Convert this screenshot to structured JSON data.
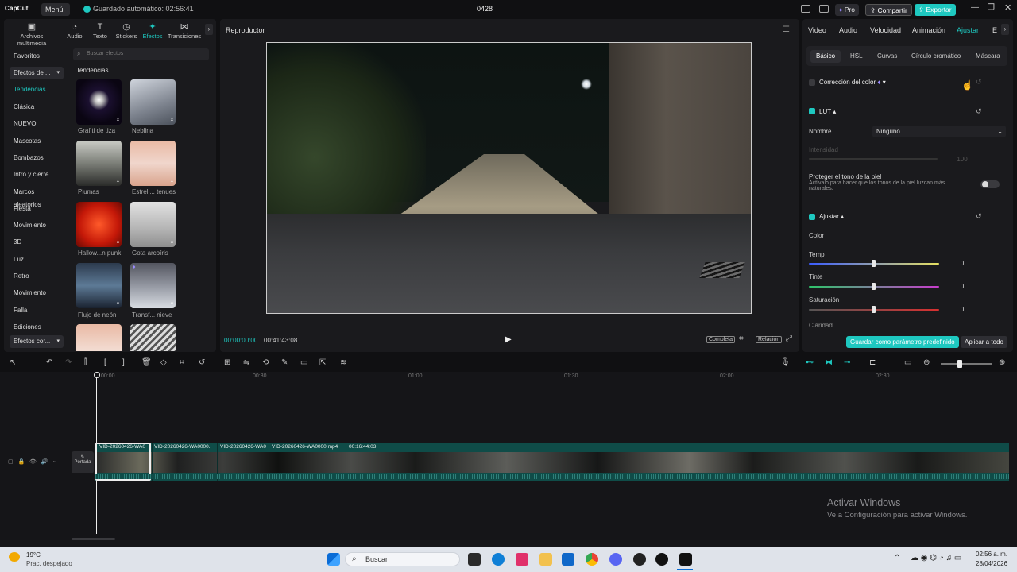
{
  "titlebar": {
    "app": "CapCut",
    "menu": "Menú",
    "saved": "Guardado automático: 02:56:41",
    "project": "0428",
    "pro": "Pro",
    "share": "Compartir",
    "export": "Exportar"
  },
  "left": {
    "tabs": [
      "Archivos multimedia",
      "Audio",
      "Texto",
      "Stickers",
      "Efectos",
      "Transiciones"
    ],
    "categories": [
      "Favoritos",
      "Efectos de ...",
      "Tendencias",
      "Clásica",
      "NUEVO",
      "Mascotas",
      "Bombazos",
      "Intro y cierre",
      "Marcos aleatorios",
      "Fiesta",
      "Movimiento",
      "3D",
      "Luz",
      "Retro",
      "Movimiento",
      "Falla",
      "Ediciones",
      "Efectos cor..."
    ],
    "search_placeholder": "Buscar efectos",
    "section": "Tendencias",
    "effects": [
      "Grafiti de tiza",
      "Neblina",
      "Plumas",
      "Estrell... tenues",
      "Hallow...n punk",
      "Gota arcoíris",
      "Flujo de neón",
      "Transf... nieve"
    ]
  },
  "player": {
    "title": "Reproductor",
    "time_current": "00:00:00:00",
    "time_total": "00:41:43:08",
    "full": "Completa",
    "ratio": "Relación"
  },
  "right": {
    "tabs": [
      "Video",
      "Audio",
      "Velocidad",
      "Animación",
      "Ajustar",
      "E"
    ],
    "subtabs": [
      "Básico",
      "HSL",
      "Curvas",
      "Círculo cromático",
      "Máscara"
    ],
    "color_correction": "Corrección del color",
    "lut": "LUT",
    "name_label": "Nombre",
    "name_value": "Ninguno",
    "intensity_label": "Intensidad",
    "intensity_value": "100",
    "skin_title": "Proteger el tono de la piel",
    "skin_desc": "Actívalo para hacer que los tonos de la piel luzcan más naturales.",
    "adjust": "Ajustar",
    "color": "Color",
    "temp": "Temp",
    "temp_value": "0",
    "tint": "Tinte",
    "tint_value": "0",
    "sat": "Saturación",
    "sat_value": "0",
    "clarity": "Claridad",
    "save_preset": "Guardar como parámetro predefinido",
    "apply_all": "Aplicar a todo"
  },
  "timeline": {
    "ticks": [
      "00:00",
      "00:30",
      "01:00",
      "01:30",
      "02:00",
      "02:30"
    ],
    "clips": [
      "VID-20260426-WA0",
      "VID-20260426-WA0000.",
      "VID-20260426-WA0",
      "VID-20260426-WA0000.mp4",
      "00:16:44:03"
    ],
    "cover": "Portada"
  },
  "watermark": {
    "line1": "Activar Windows",
    "line2": "Ve a Configuración para activar Windows."
  },
  "taskbar": {
    "temp": "19°C",
    "weather": "Prac. despejado",
    "search": "Buscar",
    "time": "02:56 a. m.",
    "date": "28/04/2026"
  }
}
